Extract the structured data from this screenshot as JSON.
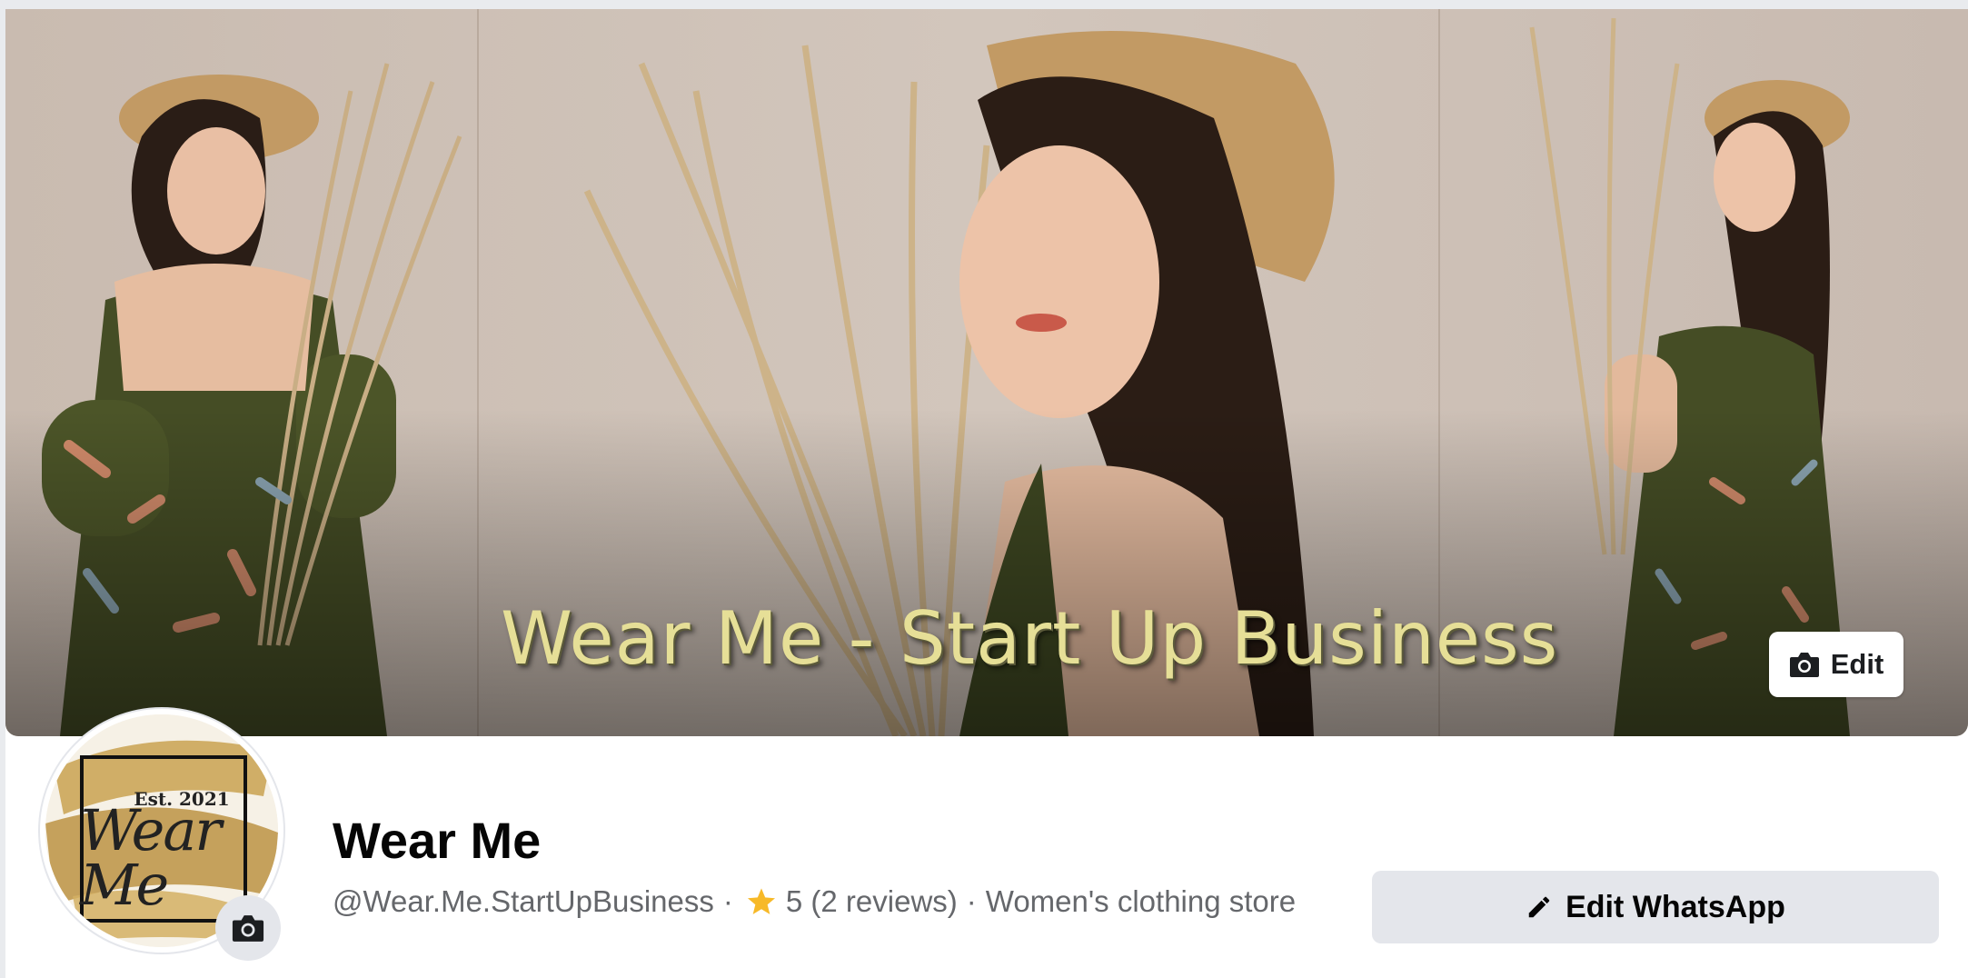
{
  "cover": {
    "title_text": "Wear Me - Start Up Business",
    "edit_label": "Edit",
    "edit_icon": "camera-icon"
  },
  "avatar": {
    "text_est": "Est. 2021",
    "text_logo": "Wear Me",
    "camera_icon": "camera-icon"
  },
  "page": {
    "name": "Wear Me",
    "handle": "@Wear.Me.StartUpBusiness",
    "separator": "·",
    "rating_icon": "star-icon",
    "rating_text": "5 (2 reviews)",
    "category": "Women's clothing store"
  },
  "actions": {
    "edit_whatsapp_label": "Edit WhatsApp",
    "edit_whatsapp_icon": "pencil-icon"
  },
  "colors": {
    "star": "#f7b928",
    "button_gray": "#e4e6eb",
    "title_text": "#050505",
    "meta_text": "#65676b"
  }
}
